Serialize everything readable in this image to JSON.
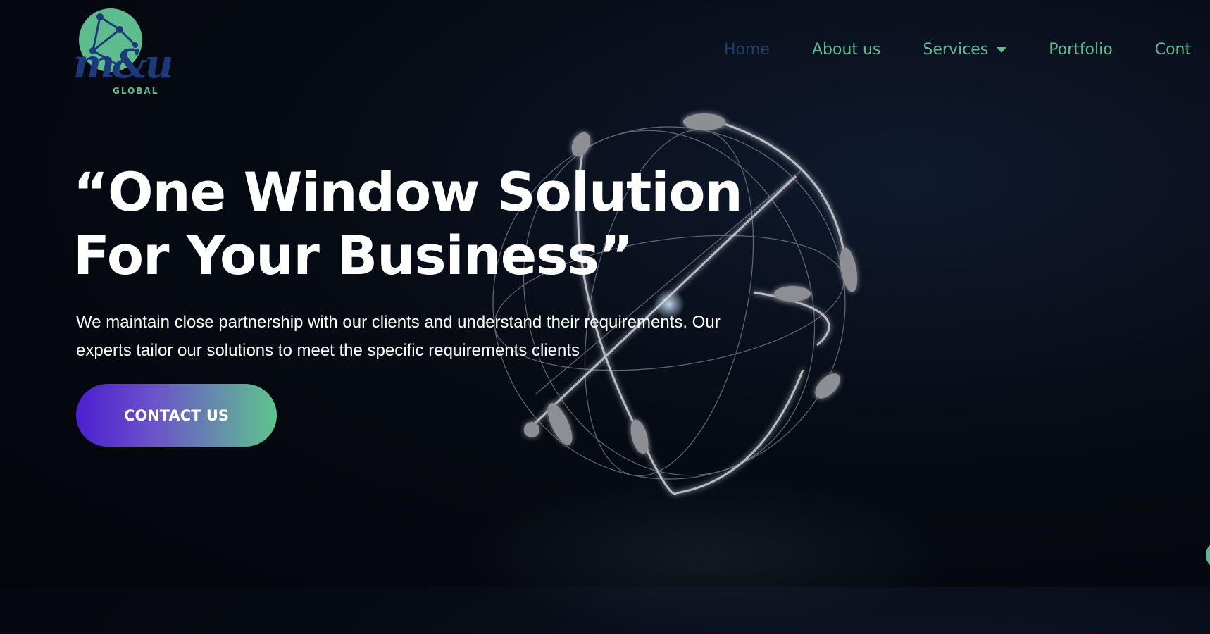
{
  "logo": {
    "script_text": "m&u",
    "subtitle": "GLOBAL",
    "icon": "network-globe-icon"
  },
  "nav": {
    "items": [
      {
        "label": "Home",
        "active": true
      },
      {
        "label": "About us",
        "active": false
      },
      {
        "label": "Services",
        "active": false,
        "has_dropdown": true
      },
      {
        "label": "Portfolio",
        "active": false
      },
      {
        "label": "Cont",
        "active": false
      }
    ]
  },
  "hero": {
    "title_line1": "“One Window Solution",
    "title_line2": "For Your Business”",
    "description_line1": "We maintain close partnership with our clients and understand their requirements. Our",
    "description_line2": "experts tailor our solutions to meet the specific requirements clients",
    "cta_label": "CONTACT US"
  },
  "colors": {
    "accent_green": "#5ebd8f",
    "nav_active": "#1f3f6b",
    "cta_gradient_start": "#4d1fd1",
    "cta_gradient_end": "#5ec48e",
    "background": "#05080f"
  }
}
